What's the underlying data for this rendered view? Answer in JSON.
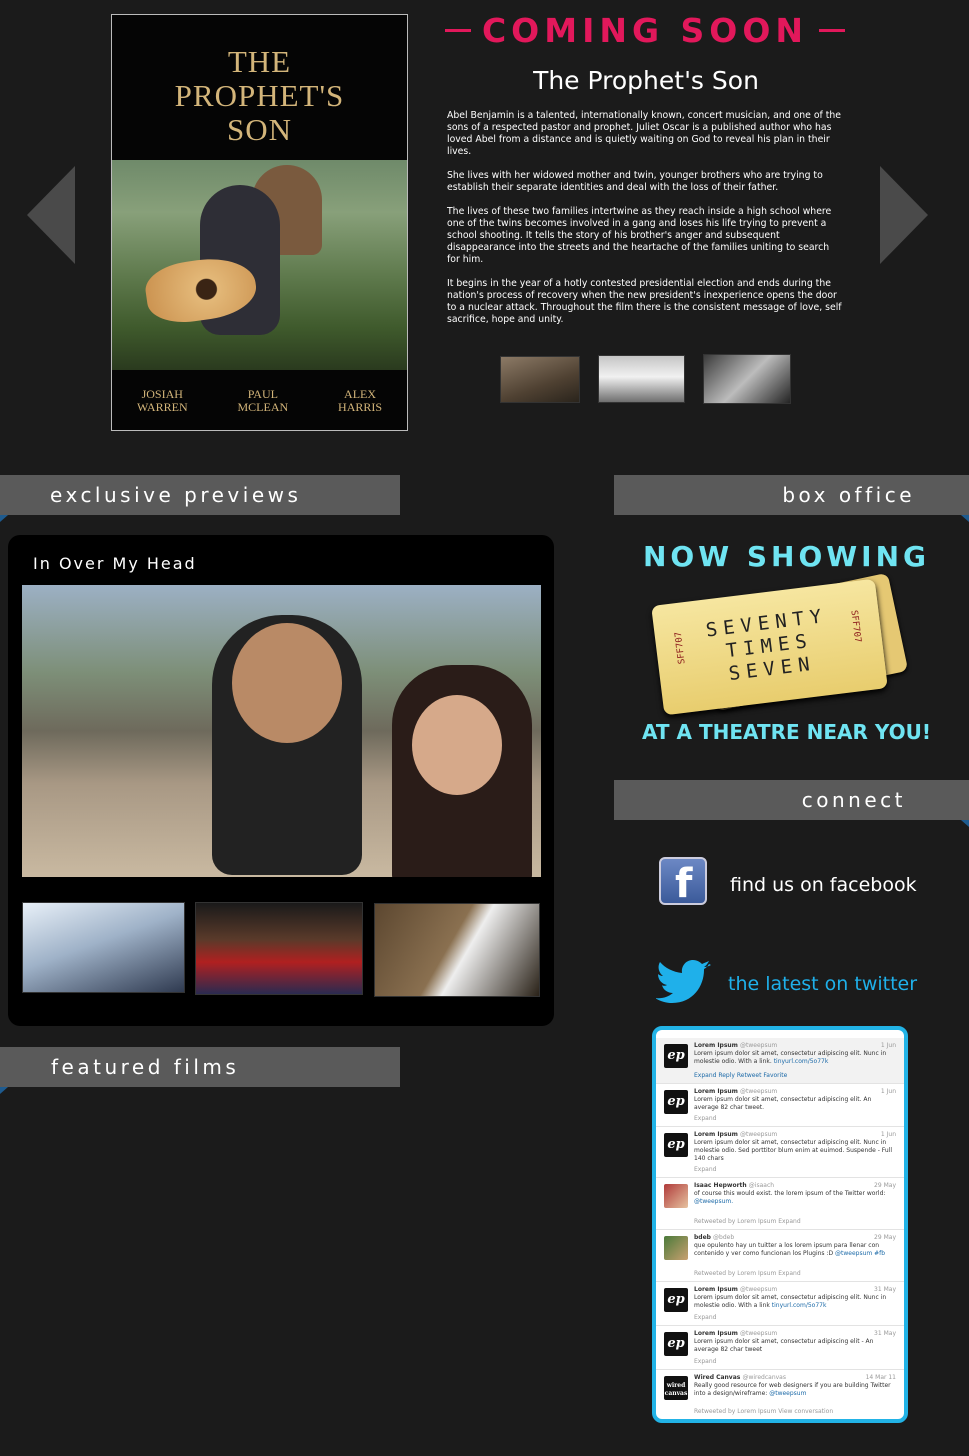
{
  "hero": {
    "poster": {
      "title_line1": "THE",
      "title_line2": "PROPHET'S",
      "title_line3": "SON",
      "credits": [
        {
          "first": "JOSIAH",
          "last": "WARREN"
        },
        {
          "first": "PAUL",
          "last": "MCLEAN"
        },
        {
          "first": "ALEX",
          "last": "HARRIS"
        }
      ]
    },
    "coming_soon": "COMING SOON",
    "film_title": "The Prophet's Son",
    "synopsis": [
      "Abel Benjamin is a talented, internationally known, concert musician, and one of the sons of a respected pastor and prophet. Juliet Oscar is a published author who has loved Abel from a distance and is quietly waiting on God to reveal his plan in their lives.",
      "She lives with her widowed mother and twin, younger brothers who are trying to establish their separate identities and deal with the loss of their father.",
      "The lives of these two families intertwine as they reach inside a high school where one of the twins becomes involved in a gang and loses his life trying to prevent a school shooting. It tells the story of his brother's anger and subsequent disappearance into the streets and the heartache of the families uniting to search for him.",
      "It begins in the year of a hotly contested presidential election and ends during the nation's process of recovery when the new president's inexperience opens the door to a nuclear attack. Throughout the film there is the consistent message of love, self sacrifice, hope and unity."
    ]
  },
  "sections": {
    "exclusive_previews": "exclusive previews",
    "featured_films": "featured films",
    "box_office": "box office",
    "connect": "connect"
  },
  "preview": {
    "title": "In Over My Head"
  },
  "box_office": {
    "now_showing": "NOW SHOWING",
    "ticket_line1": "SEVENTY",
    "ticket_line2": "TIMES",
    "ticket_line3": "SEVEN",
    "ticket_serial": "SFF707",
    "theatre": "AT A THEATRE NEAR YOU!"
  },
  "connect": {
    "facebook_glyph": "f",
    "facebook_text": "find us on facebook",
    "twitter_text": "the latest on twitter",
    "colors": {
      "twitter": "#1fb0ea",
      "accent": "#e2185b",
      "cyan": "#6fe4f2"
    }
  },
  "tweets": [
    {
      "avatar": "tw",
      "name": "Lorem Ipsum",
      "handle": "@tweepsum",
      "date": "1 Jun",
      "text": "Lorem ipsum dolor sit amet, consectetur adipiscing elit. Nunc in molestie odio. With a link. ",
      "link": "tinyurl.com/5o77k",
      "meta": "Expand   Reply   Retweet   Favorite"
    },
    {
      "avatar": "tw",
      "name": "Lorem Ipsum",
      "handle": "@tweepsum",
      "date": "1 Jun",
      "text": "Lorem ipsum dolor sit amet, consectetur adipiscing elit. An average 82 char tweet.",
      "link": "",
      "meta": "Expand"
    },
    {
      "avatar": "tw",
      "name": "Lorem Ipsum",
      "handle": "@tweepsum",
      "date": "1 Jun",
      "text": "Lorem ipsum dolor sit amet, consectetur adipiscing elit. Nunc in molestie odio. Sed porttitor blum enim at euimod. Suspende - Full 140 chars",
      "link": "",
      "meta": "Expand"
    },
    {
      "avatar": "photo",
      "name": "Isaac Hepworth",
      "handle": "@isaach",
      "date": "29 May",
      "text": "of course this would exist. the lorem ipsum of the Twitter world: ",
      "link": "@tweepsum.",
      "meta": "Retweeted by Lorem Ipsum  Expand"
    },
    {
      "avatar": "photo2",
      "name": "bdeb",
      "handle": "@bdeb",
      "date": "29 May",
      "text": "que opulento hay un tuitter a los lorem ipsum para llenar con contenido y ver como funcionan los Plugins :D ",
      "link": "@tweepsum #fb",
      "meta": "Retweeted by Lorem Ipsum  Expand"
    },
    {
      "avatar": "tw",
      "name": "Lorem Ipsum",
      "handle": "@tweepsum",
      "date": "31 May",
      "text": "Lorem ipsum dolor sit amet, consectetur adipiscing elit. Nunc in molestie odio. With a link ",
      "link": "tinyurl.com/5o77k",
      "meta": "Expand"
    },
    {
      "avatar": "tw",
      "name": "Lorem Ipsum",
      "handle": "@tweepsum",
      "date": "31 May",
      "text": "Lorem ipsum dolor sit amet, consectetur adipiscing elit - An average 82 char tweet",
      "link": "",
      "meta": "Expand"
    },
    {
      "avatar": "wc",
      "name": "Wired Canvas",
      "handle": "@wiredcanvas",
      "date": "14 Mar 11",
      "text": "Really good resource for web designers if you are building Twitter into a design/wireframe: ",
      "link": "@tweepsum",
      "meta": "Retweeted by Lorem Ipsum  View conversation"
    }
  ],
  "avatar_text": {
    "tw": "ep",
    "wc": "wired canvas"
  }
}
